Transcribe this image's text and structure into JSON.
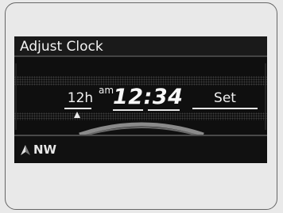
{
  "screen": {
    "title": "Adjust Clock",
    "hour_mode": "12h",
    "meridiem": "am",
    "time": "12:34",
    "set_label": "Set",
    "compass": {
      "heading": "NW",
      "icon": "compass-arrow-icon"
    }
  },
  "colors": {
    "display_bg": "#0f0f0f",
    "text": "#f0f0f0",
    "arch": "#8a8a8a"
  }
}
